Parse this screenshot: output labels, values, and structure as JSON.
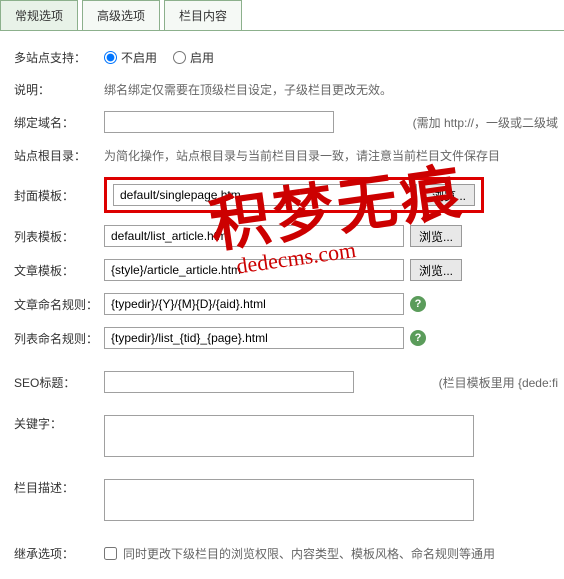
{
  "tabs": [
    "常规选项",
    "高级选项",
    "栏目内容"
  ],
  "labels": {
    "multisite": "多站点支持：",
    "desc": "说明：",
    "domain": "绑定域名：",
    "siteroot": "站点根目录：",
    "cover_tpl": "封面模板：",
    "list_tpl": "列表模板：",
    "article_tpl": "文章模板：",
    "article_rule": "文章命名规则：",
    "list_rule": "列表命名规则：",
    "seo_title": "SEO标题：",
    "keywords": "关键字：",
    "col_desc": "栏目描述：",
    "inherit": "继承选项："
  },
  "radio": {
    "off": "不启用",
    "on": "启用"
  },
  "hints": {
    "desc": "绑名绑定仅需要在顶级栏目设定，子级栏目更改无效。",
    "domain": "(需加 http://，一级或二级域",
    "siteroot": "为简化操作，站点根目录与当前栏目目录一致，请注意当前栏目文件保存目",
    "seo": "(栏目模板里用 {dede:fi",
    "inherit": "同时更改下级栏目的浏览权限、内容类型、模板风格、命名规则等通用"
  },
  "values": {
    "cover_tpl": "default/singlepage.htm",
    "list_tpl": "default/list_article.htm",
    "article_tpl": "{style}/article_article.htm",
    "article_rule": "{typedir}/{Y}/{M}{D}/{aid}.html",
    "list_rule": "{typedir}/list_{tid}_{page}.html"
  },
  "btn_browse": "浏览...",
  "watermark": {
    "line1": "积梦无痕",
    "line2": "dedecms.com"
  }
}
